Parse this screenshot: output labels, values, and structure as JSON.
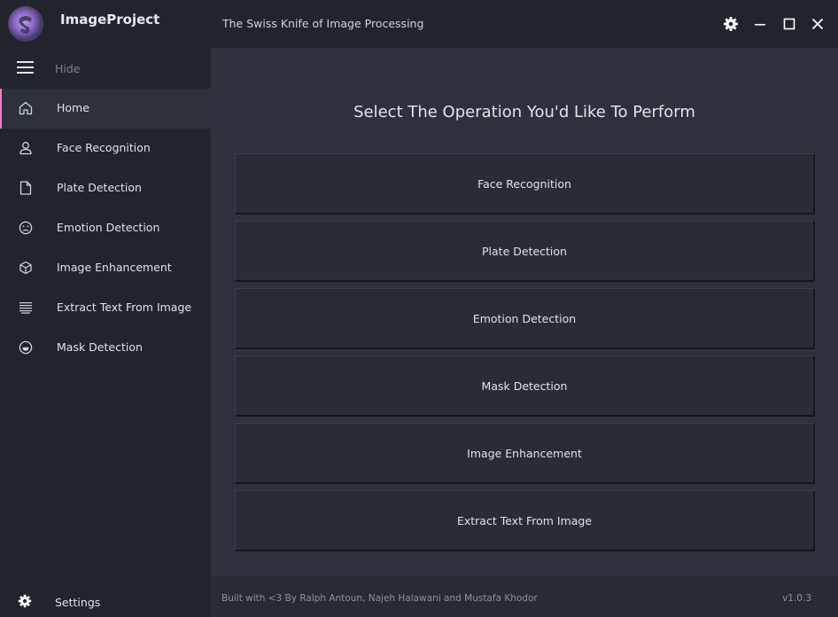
{
  "window": {
    "app_name": "ImageProject",
    "subtitle": "The Swiss Knife of Image Processing",
    "controls": [
      "settings-icon",
      "minimize-icon",
      "maximize-icon",
      "close-icon"
    ]
  },
  "sidebar": {
    "toggle_label": "Hide",
    "items": [
      {
        "label": "Home",
        "icon": "home-icon",
        "active": true
      },
      {
        "label": "Face Recognition",
        "icon": "user-icon"
      },
      {
        "label": "Plate Detection",
        "icon": "document-icon"
      },
      {
        "label": "Emotion Detection",
        "icon": "sad-face-icon"
      },
      {
        "label": "Image Enhancement",
        "icon": "cube-icon"
      },
      {
        "label": "Extract Text From Image",
        "icon": "text-lines-icon"
      },
      {
        "label": "Mask Detection",
        "icon": "smile-face-icon"
      }
    ],
    "settings_label": "Settings"
  },
  "main": {
    "title": "Select The Operation You'd Like To Perform",
    "operations": [
      "Face Recognition",
      "Plate Detection",
      "Emotion Detection",
      "Mask Detection",
      "Image Enhancement",
      "Extract Text From Image"
    ]
  },
  "footer": {
    "credits": "Built with <3 By Ralph Antoun, Najeh Halawani and Mustafa Khodor",
    "version": "v1.0.3"
  },
  "colors": {
    "active_accent": "#ff79c6",
    "background": "#2c313c",
    "sidebar": "#21252b"
  }
}
